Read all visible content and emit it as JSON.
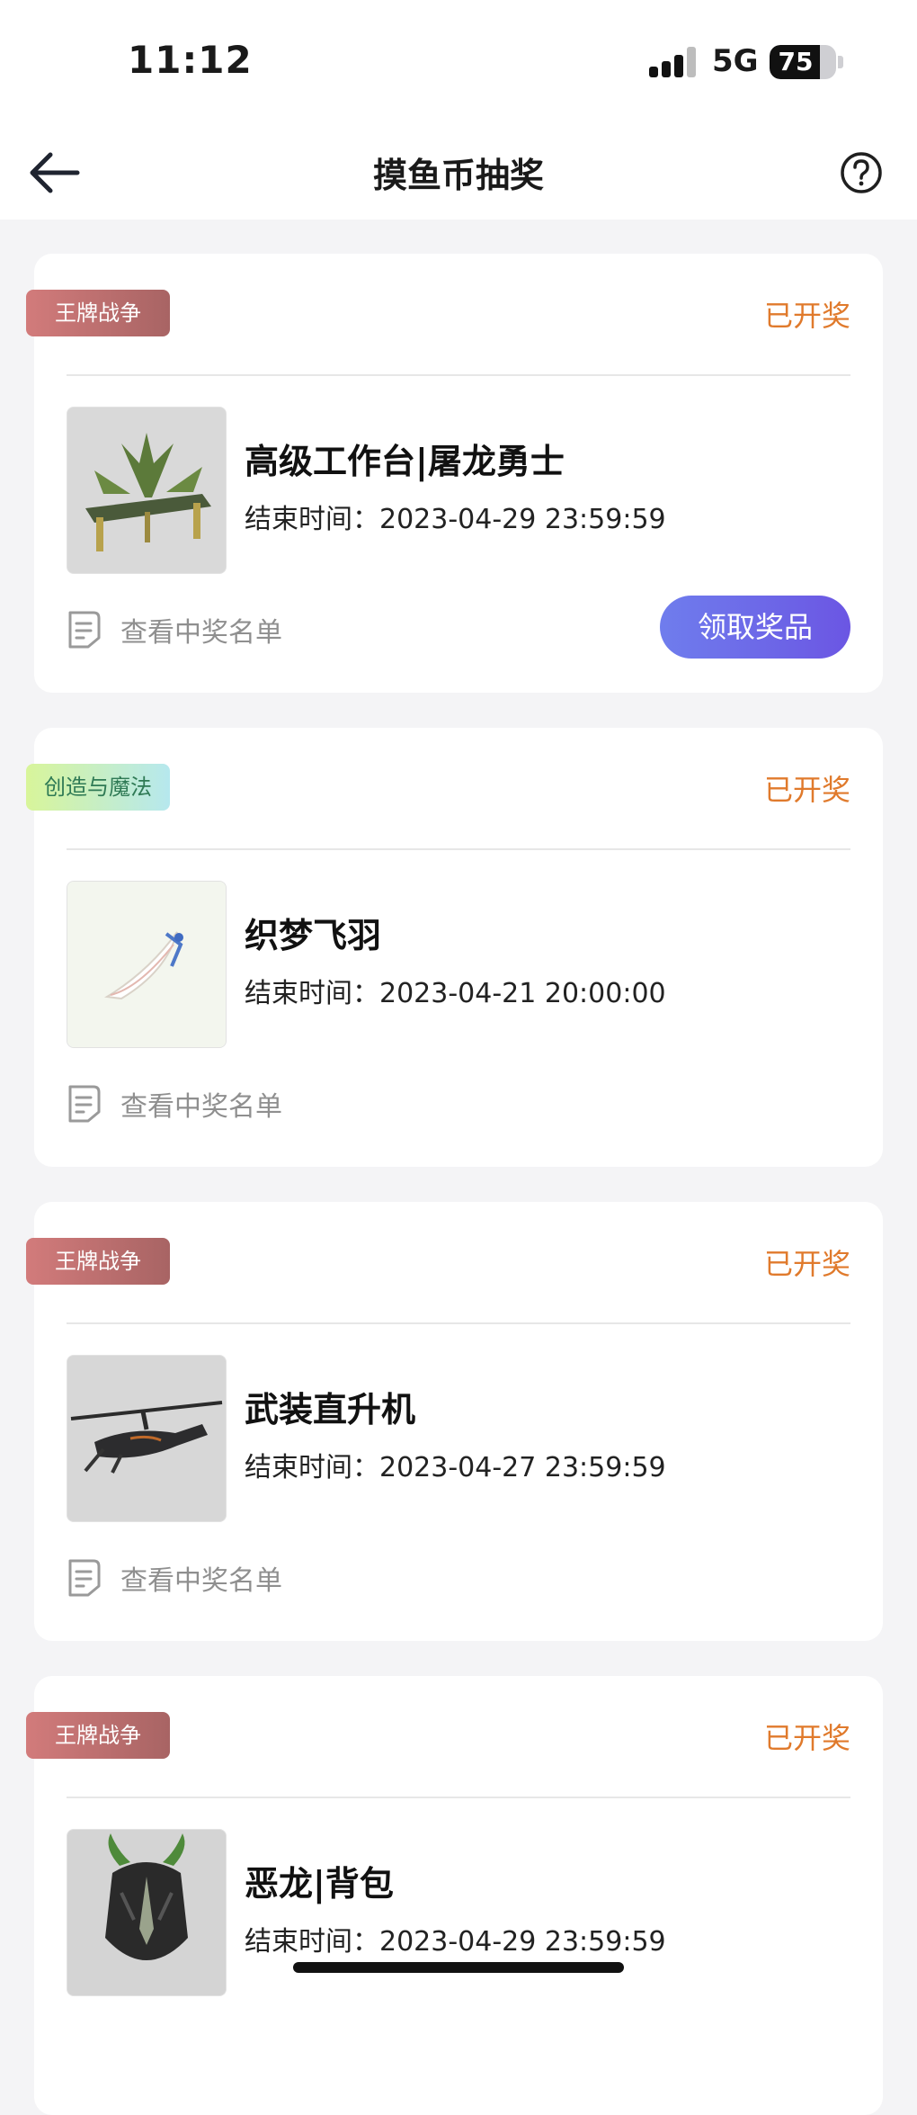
{
  "status_bar": {
    "time": "11:12",
    "network": "5G",
    "battery": "75",
    "battery_level": 0.75
  },
  "header": {
    "title": "摸鱼币抽奖",
    "back_icon": "back-arrow-icon",
    "help_icon": "question-circle-icon"
  },
  "colors": {
    "status": "#e07a2c",
    "claim_button": "#6b56e3",
    "tag_war": "#b86d6d",
    "tag_magic": "#c8efc4"
  },
  "cards": [
    {
      "tag": "王牌战争",
      "status": "已开奖",
      "title": "高级工作台|屠龙勇士",
      "end_label": "结束时间：",
      "end_time": "2023-04-29 23:59:59",
      "winners_label": "查看中奖名单",
      "action": "领取奖品"
    },
    {
      "tag": "创造与魔法",
      "status": "已开奖",
      "title": "织梦飞羽",
      "end_label": "结束时间：",
      "end_time": "2023-04-21 20:00:00",
      "winners_label": "查看中奖名单"
    },
    {
      "tag": "王牌战争",
      "status": "已开奖",
      "title": "武装直升机",
      "end_label": "结束时间：",
      "end_time": "2023-04-27 23:59:59",
      "winners_label": "查看中奖名单"
    },
    {
      "tag": "王牌战争",
      "status": "已开奖",
      "title": "恶龙|背包",
      "end_label": "结束时间：",
      "end_time": "2023-04-29 23:59:59"
    }
  ]
}
